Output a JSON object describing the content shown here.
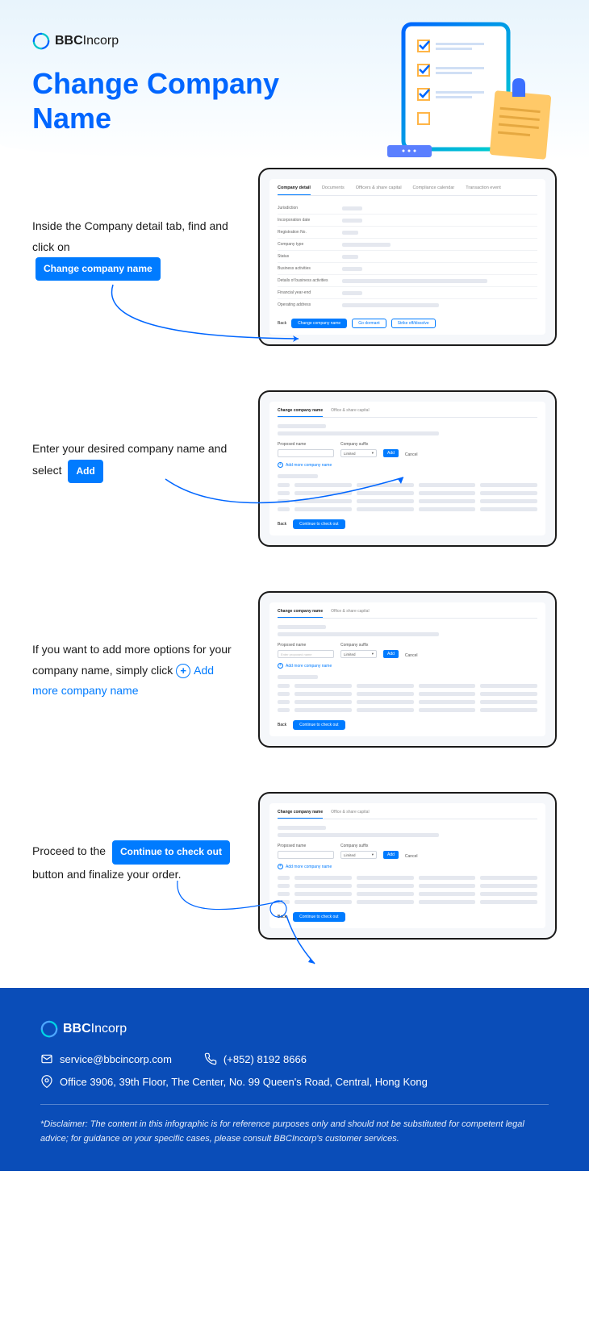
{
  "brand": {
    "name_bold": "BBC",
    "name_thin": "Incorp"
  },
  "page_title": "Change Company Name",
  "steps": {
    "s1": {
      "text_a": "Inside the Company detail tab, find and click on",
      "btn": "Change company name",
      "mock": {
        "tabs": [
          "Company detail",
          "Documents",
          "Officers & share capital",
          "Compliance calendar",
          "Transaction event"
        ],
        "rows": [
          "Jurisdiction",
          "Incorporation date",
          "Registration No.",
          "Company type",
          "Status",
          "Business activities",
          "Details of business activities",
          "Financial year-end",
          "Operating address"
        ],
        "back": "Back",
        "primary": "Change company name",
        "outline1": "Go dormant",
        "outline2": "Strike off/dissolve"
      }
    },
    "s2": {
      "text_a": "Enter your desired company name and select",
      "btn": "Add",
      "mock": {
        "subtabs": [
          "Change company name",
          "Office & share capital"
        ],
        "proposed": "Proposed name",
        "suffix": "Company suffix",
        "suffix_val": "Limited",
        "add": "Add",
        "cancel": "Cancel",
        "add_more": "Add more company name",
        "back": "Back",
        "continue": "Continue to check out"
      }
    },
    "s3": {
      "text_a": "If you want to add more options for your company name, simply click",
      "link": "Add more company name"
    },
    "s4": {
      "text_a": "Proceed to the",
      "btn": "Continue to check out",
      "text_b": "button and finalize your order."
    }
  },
  "footer": {
    "email": "service@bbcincorp.com",
    "phone": "(+852) 8192 8666",
    "address": "Office 3906, 39th Floor, The Center, No. 99 Queen's Road, Central, Hong Kong",
    "disclaimer": "*Disclaimer: The content in this infographic is for reference purposes only and should not be substituted for competent legal advice; for guidance on your specific cases, please consult BBCIncorp's customer services."
  }
}
